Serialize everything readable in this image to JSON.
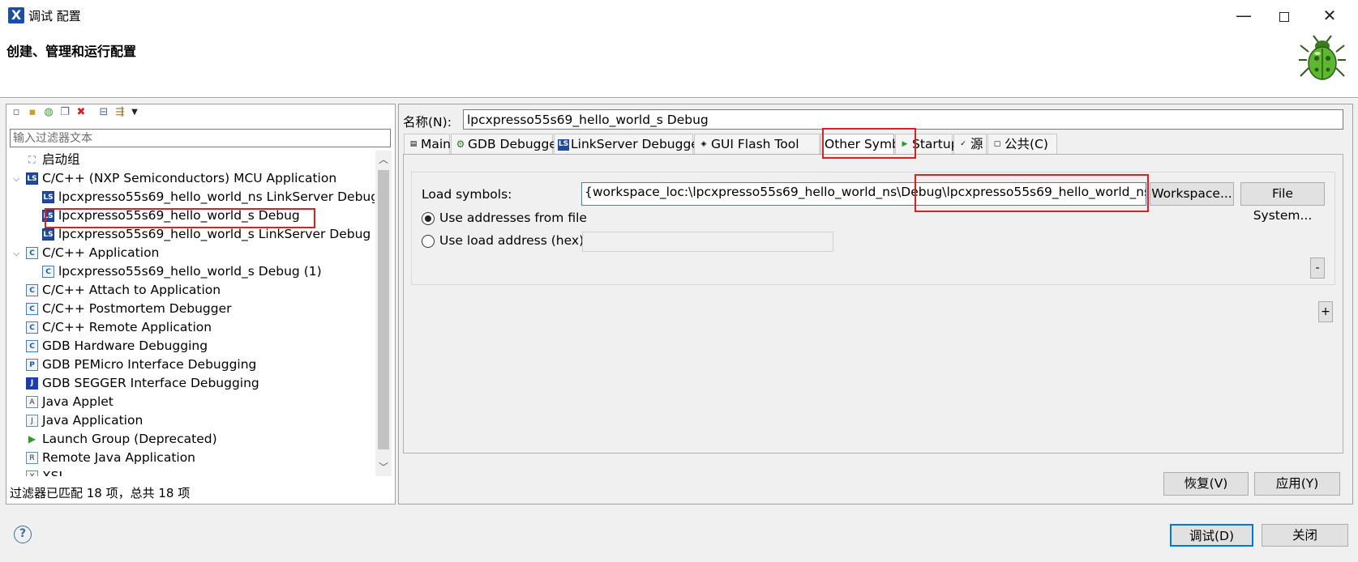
{
  "window": {
    "title": "调试 配置",
    "app_icon": "X",
    "minimize": "—",
    "close": "✕"
  },
  "banner": {
    "title": "创建、管理和运行配置",
    "icon": "bug-icon"
  },
  "left": {
    "filter_placeholder": "输入过滤器文本",
    "status": "过滤器已匹配 18 项，总共 18 项",
    "tree": [
      {
        "label": "启动组",
        "icon": "launch-group-icon"
      },
      {
        "label": "C/C++ (NXP Semiconductors) MCU Application",
        "icon": "ls-icon",
        "expanded": true
      },
      {
        "label": "lpcxpresso55s69_hello_world_ns LinkServer Debug",
        "icon": "ls-icon"
      },
      {
        "label": "lpcxpresso55s69_hello_world_s Debug",
        "icon": "ls-icon",
        "selected": true
      },
      {
        "label": "lpcxpresso55s69_hello_world_s LinkServer Debug",
        "icon": "ls-icon"
      },
      {
        "label": "C/C++ Application",
        "icon": "c-icon",
        "expanded": true
      },
      {
        "label": "lpcxpresso55s69_hello_world_s Debug  (1)",
        "icon": "c-icon"
      },
      {
        "label": "C/C++ Attach to Application",
        "icon": "c-icon"
      },
      {
        "label": "C/C++ Postmortem Debugger",
        "icon": "c-icon"
      },
      {
        "label": "C/C++ Remote Application",
        "icon": "c-icon"
      },
      {
        "label": "GDB Hardware Debugging",
        "icon": "c-icon"
      },
      {
        "label": "GDB PEMicro Interface Debugging",
        "icon": "pemicro-icon"
      },
      {
        "label": "GDB SEGGER Interface Debugging",
        "icon": "jlink-icon"
      },
      {
        "label": "Java Applet",
        "icon": "java-applet-icon"
      },
      {
        "label": "Java Application",
        "icon": "java-app-icon"
      },
      {
        "label": "Launch Group (Deprecated)",
        "icon": "launch-icon"
      },
      {
        "label": "Remote Java Application",
        "icon": "remote-java-icon"
      },
      {
        "label": "XSL",
        "icon": "xsl-icon"
      }
    ]
  },
  "right": {
    "name_label": "名称(N):",
    "name_value": "lpcxpresso55s69_hello_world_s Debug",
    "tabs": [
      {
        "label": "Main",
        "icon": "main-tab-icon"
      },
      {
        "label": "GDB Debugger",
        "icon": "debugger-icon"
      },
      {
        "label": "LinkServer Debugger",
        "icon": "ls-icon"
      },
      {
        "label": "GUI Flash Tool",
        "icon": "flash-icon"
      },
      {
        "label": "Other Symbols",
        "icon": "",
        "active": true
      },
      {
        "label": "Startup",
        "icon": "startup-icon"
      },
      {
        "label": "源",
        "icon": "source-icon"
      },
      {
        "label": "公共(C)",
        "icon": "common-icon"
      }
    ],
    "load_symbols_label": "Load symbols:",
    "load_symbols_value": "{workspace_loc:\\lpcxpresso55s69_hello_world_ns\\Debug\\lpcxpresso55s69_hello_world_ns.axf}",
    "workspace_btn": "Workspace...",
    "filesystem_btn": "File System...",
    "radio_from_file": "Use addresses from file",
    "radio_load_address": "Use load address (hex):",
    "minus": "-",
    "plus": "+",
    "revert": "恢复(V)",
    "apply": "应用(Y)"
  },
  "footer": {
    "help": "?",
    "debug": "调试(D)",
    "close": "关闭"
  }
}
